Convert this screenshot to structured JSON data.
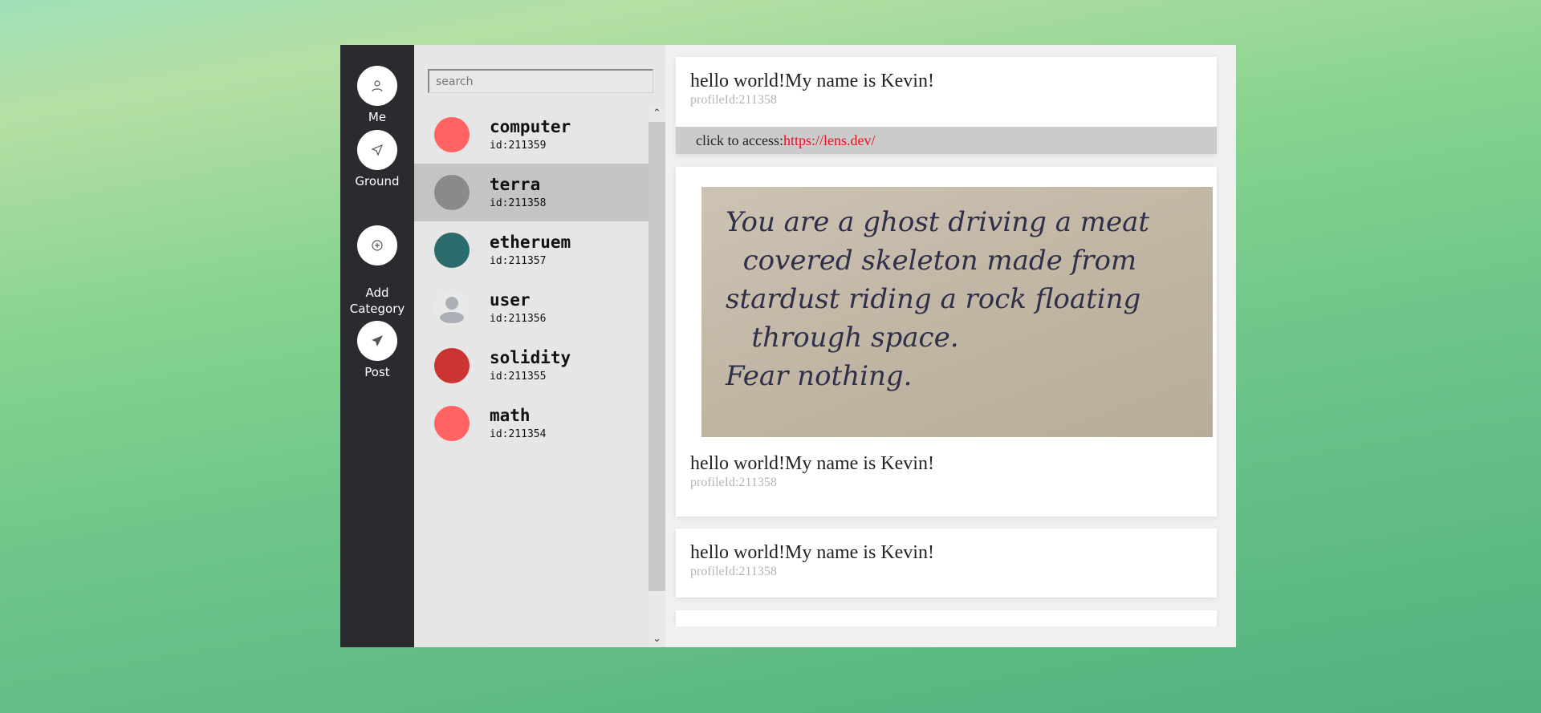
{
  "sidebar": {
    "items": [
      {
        "label": "Me",
        "icon": "user-icon"
      },
      {
        "label": "Ground",
        "icon": "navigation-icon"
      },
      {
        "label": "Add\nCategory",
        "icon": "plus-circle-icon"
      },
      {
        "label": "Post",
        "icon": "send-icon"
      }
    ]
  },
  "list": {
    "search_placeholder": "search",
    "items": [
      {
        "name": "computer",
        "id": "id:211359",
        "color": "#ff6262"
      },
      {
        "name": "terra",
        "id": "id:211358",
        "color": "#8a8a8a",
        "selected": true
      },
      {
        "name": "etheruem",
        "id": "id:211357",
        "color": "#2c6b6b"
      },
      {
        "name": "user",
        "id": "id:211356",
        "color": "default-avatar"
      },
      {
        "name": "solidity",
        "id": "id:211355",
        "color": "#cc3333"
      },
      {
        "name": "math",
        "id": "id:211354",
        "color": "#ff6262"
      }
    ]
  },
  "posts": [
    {
      "title": "hello world!My name is Kevin!",
      "profile": "profileId:211358",
      "link_prefix": "click to access:",
      "link": "https://lens.dev/"
    },
    {
      "title": "hello world!My name is Kevin!",
      "profile": "profileId:211358",
      "image_text": "You are a ghost driving a meat\n  covered skeleton made from\nstardust riding a rock floating\n   through space.\nFear nothing."
    },
    {
      "title": "hello world!My name is Kevin!",
      "profile": "profileId:211358"
    }
  ]
}
